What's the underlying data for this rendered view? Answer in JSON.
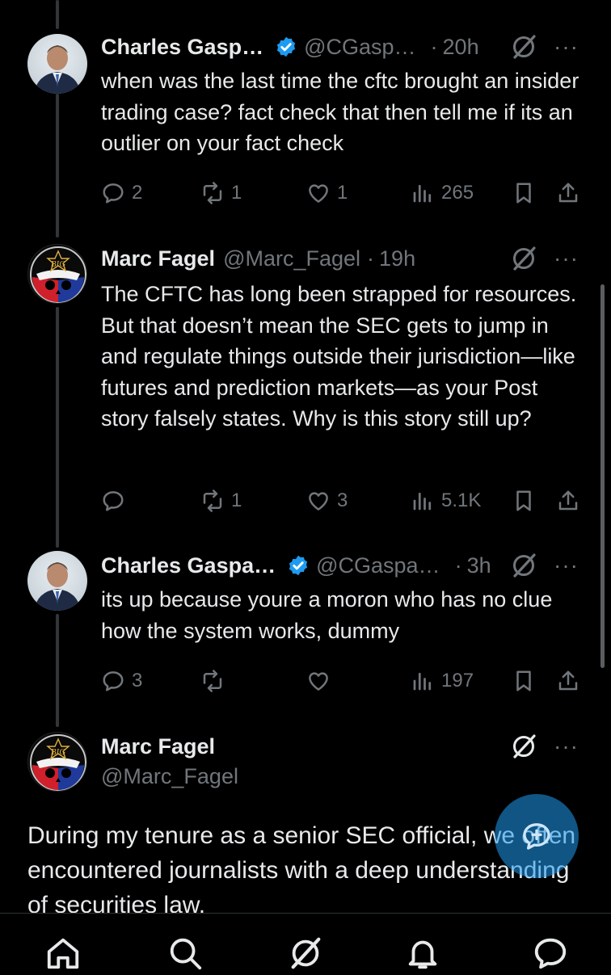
{
  "tweets": [
    {
      "name": "Charles Gasp…",
      "handle": "@CGasp…",
      "dot": "·",
      "time": "20h",
      "more": "···",
      "text": "when was the last time the cftc brought an insider trading case? fact check that then tell me if its an outlier on your fact check",
      "replies": "2",
      "reposts": "1",
      "likes": "1",
      "views": "265",
      "verified": true,
      "avatar": "person-photo"
    },
    {
      "name": "Marc Fagel",
      "handle": "@Marc_Fagel",
      "dot": "·",
      "time": "19h",
      "more": "···",
      "text": "The CFTC has long been strapped for resources. But that doesn’t mean the SEC gets to jump in and regulate things outside their jurisdiction—like futures and prediction markets—as your Post story falsely states. Why is this story still up?",
      "replies": "",
      "reposts": "1",
      "likes": "3",
      "views": "5.1K",
      "verified": false,
      "avatar": "steal-your-face-logo"
    },
    {
      "name": "Charles Gaspa…",
      "handle": "@CGaspa…",
      "dot": "·",
      "time": "3h",
      "more": "···",
      "text": "its up because youre a moron who has no clue how the system works, dummy",
      "replies": "3",
      "reposts": "",
      "likes": "",
      "views": "197",
      "verified": true,
      "avatar": "person-photo"
    }
  ],
  "focus": {
    "name": "Marc Fagel",
    "handle": "@Marc_Fagel",
    "more": "···",
    "text": "During my tenure as a senior SEC official, we often encountered journalists with a deep understanding of securities law.",
    "avatar_badge": "BIG"
  },
  "nav": [
    "home-icon",
    "search-icon",
    "grok-icon",
    "notifications-icon",
    "messages-icon"
  ],
  "colors": {
    "background": "#000000",
    "text": "#e7e9ea",
    "muted": "#71767b",
    "verified": "#1d9bf0",
    "thread_line": "#333639"
  }
}
